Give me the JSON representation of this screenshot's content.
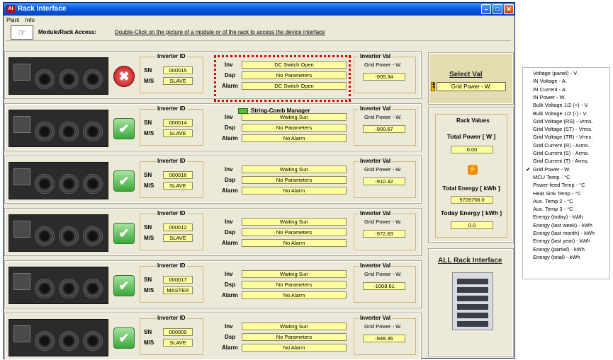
{
  "window": {
    "title": "Rack Interface",
    "app_icon": "AI"
  },
  "menu": {
    "items": [
      "Plant",
      "Info"
    ]
  },
  "access": {
    "label": "Module/Rack Access:",
    "text": "Double-Click on the picture of a module or of the rack to access the device interface"
  },
  "labels": {
    "inverter_id": "Inverter ID",
    "sn": "SN",
    "ms": "M/S",
    "inv": "Inv",
    "dsp": "Dsp",
    "alarm": "Alarm",
    "inverter_val": "Inverter Val",
    "grid_power": "Grid Power - W."
  },
  "string_comb": "String-Comb Manager",
  "modules": [
    {
      "status": "error",
      "sn": "000015",
      "ms": "SLAVE",
      "inv": "DC Switch Open",
      "dsp": "No Parameters",
      "alarm": "DC Switch Open",
      "val": "-905.34"
    },
    {
      "status": "ok",
      "sn": "000014",
      "ms": "SLAVE",
      "inv": "Waiting Sun",
      "dsp": "No Parameters",
      "alarm": "No Alarm",
      "val": "-900.67"
    },
    {
      "status": "ok",
      "sn": "000016",
      "ms": "SLAVE",
      "inv": "Waiting Sun",
      "dsp": "No Parameters",
      "alarm": "No Alarm",
      "val": "-910.32"
    },
    {
      "status": "ok",
      "sn": "000012",
      "ms": "SLAVE",
      "inv": "Waiting Sun",
      "dsp": "No Parameters",
      "alarm": "No Alarm",
      "val": "-972.63"
    },
    {
      "status": "ok",
      "sn": "000017",
      "ms": "MASTER",
      "inv": "Waiting Sun",
      "dsp": "No Parameters",
      "alarm": "No Alarm",
      "val": "-1008.61"
    },
    {
      "status": "ok",
      "sn": "000009",
      "ms": "SLAVE",
      "inv": "Waiting Sun",
      "dsp": "No Parameters",
      "alarm": "No Alarm",
      "val": "-948.36"
    }
  ],
  "select_val": {
    "title": "Select Val",
    "selected": "Grid Power - W."
  },
  "rack_values": {
    "title": "Rack Values",
    "total_power_label": "Total Power [ W ]",
    "total_power": "0.00",
    "total_energy_label": "Total Energy [ kWh ]",
    "total_energy": "9709756.0",
    "today_energy_label": "Today Energy [ kWh ]",
    "today_energy": "0.0"
  },
  "all_rack": {
    "title": "ALL Rack Interface"
  },
  "dropdown": {
    "checked_index": 12,
    "check_mark": "✔",
    "options": [
      "Voltage (panel) - V.",
      "IN Voltage - A.",
      "IN Current - A.",
      "IN Power - W.",
      "Bulk Voltage 1/2 (+) - V.",
      "Bulk Voltage 1/2 (-) - V.",
      "Grid Voltage (RS) - Vrms.",
      "Grid Voltage (ST) - Vrms.",
      "Grid Voltage (TR) - Vrms.",
      "Grid Current (R) - Arms.",
      "Grid Current (S) - Arms.",
      "Grid Current (T) - Arms.",
      "Grid Power - W.",
      "MCU Temp - °C",
      "Power-feed Temp - °C",
      "Heat Sink Temp - °C",
      "Aux. Temp 2 - °C",
      "Aux. Temp 3 - °C",
      "Energy (today) - kWh",
      "Energy (last week) - kWh",
      "Energy (last month) - kWh",
      "Energy (last year) - kWh",
      "Energy (partial) - kWh",
      "Energy (total) - kWh"
    ]
  }
}
